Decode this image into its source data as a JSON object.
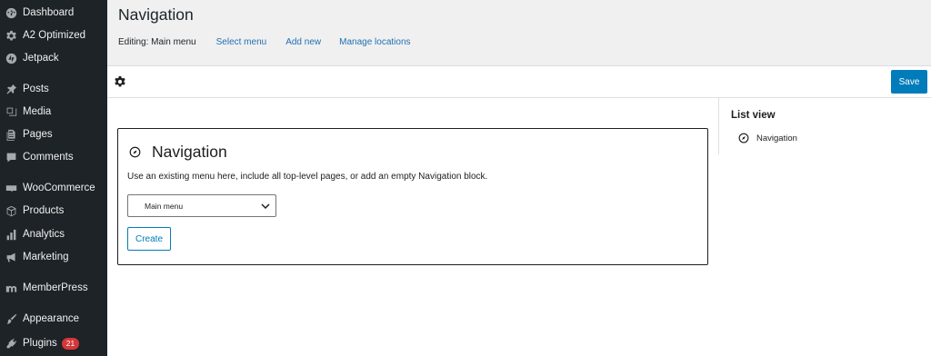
{
  "sidebar": {
    "items": [
      {
        "label": "Dashboard",
        "icon": "dashboard-icon"
      },
      {
        "label": "A2 Optimized",
        "icon": "gear-icon"
      },
      {
        "label": "Jetpack",
        "icon": "jetpack-icon"
      },
      {
        "label": "Posts",
        "icon": "pin-icon"
      },
      {
        "label": "Media",
        "icon": "media-icon"
      },
      {
        "label": "Pages",
        "icon": "page-icon"
      },
      {
        "label": "Comments",
        "icon": "comment-icon"
      },
      {
        "label": "WooCommerce",
        "icon": "woocommerce-icon"
      },
      {
        "label": "Products",
        "icon": "box-icon"
      },
      {
        "label": "Analytics",
        "icon": "bar-chart-icon"
      },
      {
        "label": "Marketing",
        "icon": "megaphone-icon"
      },
      {
        "label": "MemberPress",
        "icon": "memberpress-icon"
      },
      {
        "label": "Appearance",
        "icon": "brush-icon"
      },
      {
        "label": "Plugins",
        "icon": "plug-icon",
        "badge": "21"
      }
    ]
  },
  "header": {
    "title": "Navigation",
    "editing_label": "Editing: Main menu",
    "links": [
      "Select menu",
      "Add new",
      "Manage locations"
    ]
  },
  "toolbar": {
    "save_label": "Save",
    "accent": "#007cba"
  },
  "block": {
    "title": "Navigation",
    "description": "Use an existing menu here, include all top-level pages, or add an empty Navigation block.",
    "select_value": "Main menu",
    "create_label": "Create"
  },
  "list_view": {
    "title": "List view",
    "item_label": "Navigation"
  }
}
